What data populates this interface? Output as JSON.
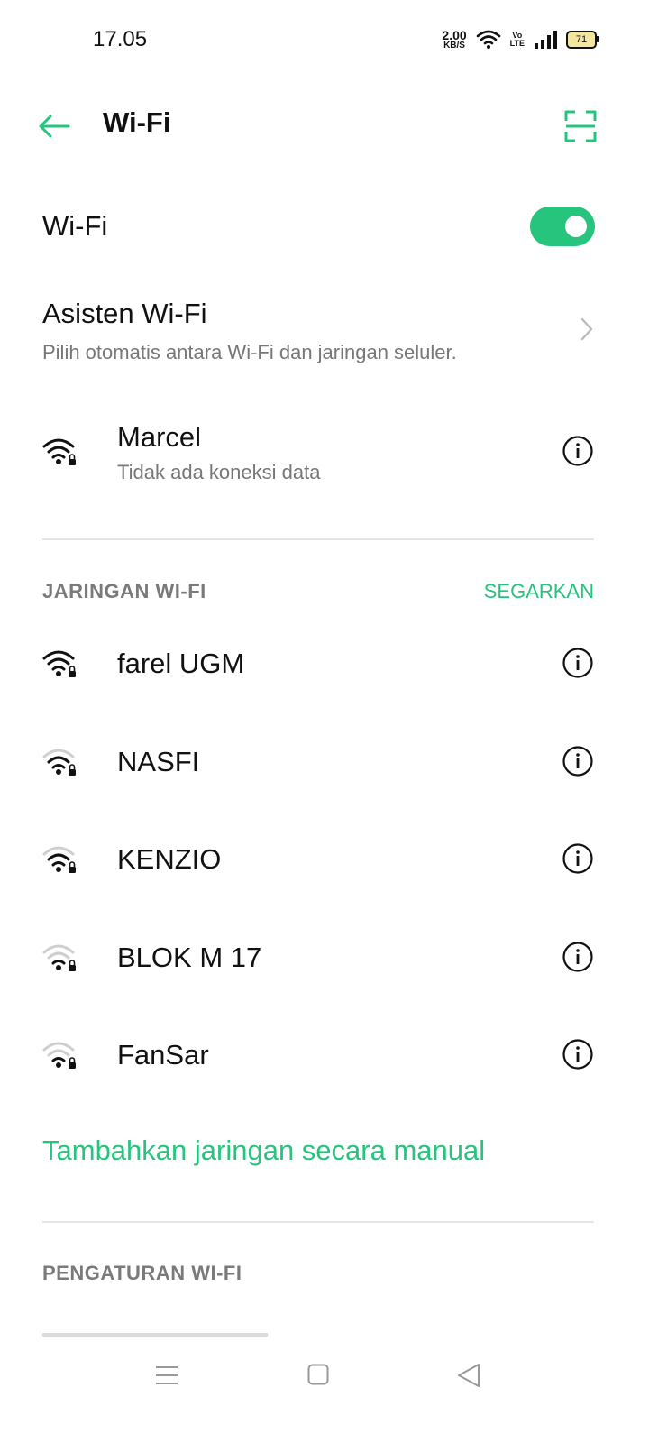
{
  "status_bar": {
    "time": "17.05",
    "speed_value": "2.00",
    "speed_unit": "KB/S",
    "volte_top": "Vo",
    "volte_bottom": "LTE",
    "battery": "71"
  },
  "header": {
    "title": "Wi-Fi"
  },
  "wifi_toggle": {
    "label": "Wi-Fi",
    "enabled": true
  },
  "assistant": {
    "title": "Asisten Wi-Fi",
    "subtitle": "Pilih otomatis antara Wi-Fi dan jaringan seluler."
  },
  "connected": {
    "name": "Marcel",
    "status": "Tidak ada koneksi data"
  },
  "networks_section": {
    "label": "JARINGAN WI-FI",
    "refresh": "SEGARKAN",
    "items": [
      {
        "name": "farel UGM",
        "signal": 4
      },
      {
        "name": "NASFI",
        "signal": 3
      },
      {
        "name": "KENZIO",
        "signal": 3
      },
      {
        "name": "BLOK M 17",
        "signal": 2
      },
      {
        "name": "FanSar",
        "signal": 2
      }
    ]
  },
  "add_manual": "Tambahkan jaringan secara manual",
  "settings_section": {
    "label": "PENGATURAN WI-FI"
  },
  "colors": {
    "accent": "#27c47d",
    "secondary_text": "#777777",
    "divider": "#e5e5e5"
  }
}
